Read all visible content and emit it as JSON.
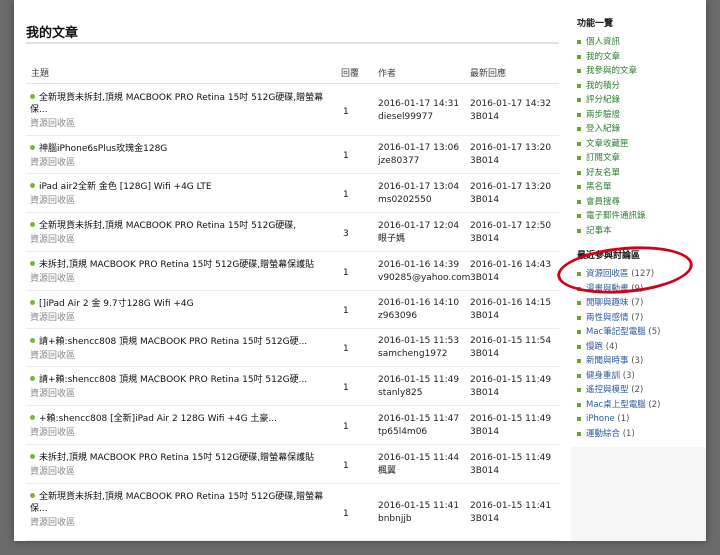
{
  "main": {
    "title": "我的文章",
    "columns": {
      "topic": "主題",
      "replies": "回覆",
      "author": "作者",
      "latest": "最新回應"
    },
    "rows": [
      {
        "topic": "全新現貨未拆封,頂規 MACBOOK PRO Retina 15吋 512G硬碟,贈螢幕保...",
        "forum": "資源回收區",
        "replies": "1",
        "post_time": "2016-01-17 14:31",
        "author": "diesel99977",
        "reply_time": "2016-01-17 14:32",
        "reply_author": "3B014"
      },
      {
        "topic": "神腦iPhone6sPlus玫瑰金128G",
        "forum": "資源回收區",
        "replies": "1",
        "post_time": "2016-01-17 13:06",
        "author": "jze80377",
        "reply_time": "2016-01-17 13:20",
        "reply_author": "3B014"
      },
      {
        "topic": "iPad air2全新 金色 [128G] Wifi +4G LTE",
        "forum": "資源回收區",
        "replies": "1",
        "post_time": "2016-01-17 13:04",
        "author": "ms0202550",
        "reply_time": "2016-01-17 13:20",
        "reply_author": "3B014"
      },
      {
        "topic": "全新現貨未拆封,頂規 MACBOOK PRO Retina 15吋 512G硬碟,",
        "forum": "資源回收區",
        "replies": "3",
        "post_time": "2016-01-17 12:04",
        "author": "眼子媽",
        "reply_time": "2016-01-17 12:50",
        "reply_author": "3B014"
      },
      {
        "topic": "未拆封,頂規 MACBOOK PRO Retina 15吋 512G硬碟,贈螢幕保護貼",
        "forum": "資源回收區",
        "replies": "1",
        "post_time": "2016-01-16 14:39",
        "author": "v90285@yahoo.com",
        "reply_time": "2016-01-16 14:43",
        "reply_author": "3B014"
      },
      {
        "topic": "[]iPad Air 2 金 9.7寸128G Wifi +4G",
        "forum": "資源回收區",
        "replies": "1",
        "post_time": "2016-01-16 14:10",
        "author": "z963096",
        "reply_time": "2016-01-16 14:15",
        "reply_author": "3B014"
      },
      {
        "topic": "請+賴:shencc808 頂規 MACBOOK PRO Retina 15吋 512G硬...",
        "forum": "資源回收區",
        "replies": "1",
        "post_time": "2016-01-15 11:53",
        "author": "samcheng1972",
        "reply_time": "2016-01-15 11:54",
        "reply_author": "3B014"
      },
      {
        "topic": "請+賴:shencc808 頂規 MACBOOK PRO Retina 15吋 512G硬...",
        "forum": "資源回收區",
        "replies": "1",
        "post_time": "2016-01-15 11:49",
        "author": "stanly825",
        "reply_time": "2016-01-15 11:49",
        "reply_author": "3B014"
      },
      {
        "topic": "+賴:shencc808 [全新]iPad Air 2 128G Wifi +4G 土豪...",
        "forum": "資源回收區",
        "replies": "1",
        "post_time": "2016-01-15 11:47",
        "author": "tp65l4m06",
        "reply_time": "2016-01-15 11:49",
        "reply_author": "3B014"
      },
      {
        "topic": "未拆封,頂規 MACBOOK PRO Retina 15吋 512G硬碟,贈螢幕保護貼",
        "forum": "資源回收區",
        "replies": "1",
        "post_time": "2016-01-15 11:44",
        "author": "楓翼",
        "reply_time": "2016-01-15 11:49",
        "reply_author": "3B014"
      },
      {
        "topic": "全新現貨未拆封,頂規 MACBOOK PRO Retina 15吋 512G硬碟,贈螢幕保...",
        "forum": "資源回收區",
        "replies": "1",
        "post_time": "2016-01-15 11:41",
        "author": "bnbnjjb",
        "reply_time": "2016-01-15 11:41",
        "reply_author": "3B014"
      }
    ]
  },
  "sidebar": {
    "functions_title": "功能一覽",
    "functions": [
      "個人資訊",
      "我的文章",
      "我參與的文章",
      "我的積分",
      "評分紀錄",
      "兩步驗證",
      "登入紀錄",
      "文章收藏匣",
      "訂閱文章",
      "好友名單",
      "黑名單",
      "會員搜尋",
      "電子郵件通訊錄",
      "記事本"
    ],
    "forums_title": "最近參與討論區",
    "forums": [
      {
        "name": "資源回收區",
        "count": "(127)"
      },
      {
        "name": "漫畫與動畫",
        "count": "(9)"
      },
      {
        "name": "閒聊與趣味",
        "count": "(7)"
      },
      {
        "name": "兩性與感情",
        "count": "(7)"
      },
      {
        "name": "Mac筆記型電腦",
        "count": "(5)"
      },
      {
        "name": "慢跑",
        "count": "(4)"
      },
      {
        "name": "新聞與時事",
        "count": "(3)"
      },
      {
        "name": "健身重訓",
        "count": "(3)"
      },
      {
        "name": "遙控與模型",
        "count": "(2)"
      },
      {
        "name": "Mac桌上型電腦",
        "count": "(2)"
      },
      {
        "name": "iPhone",
        "count": "(1)"
      },
      {
        "name": "運動綜合",
        "count": "(1)"
      }
    ]
  },
  "colors": {
    "bullet": "#7bb342",
    "sidebar_link": "#2e7d32",
    "annotation_circle": "#d0021b"
  }
}
